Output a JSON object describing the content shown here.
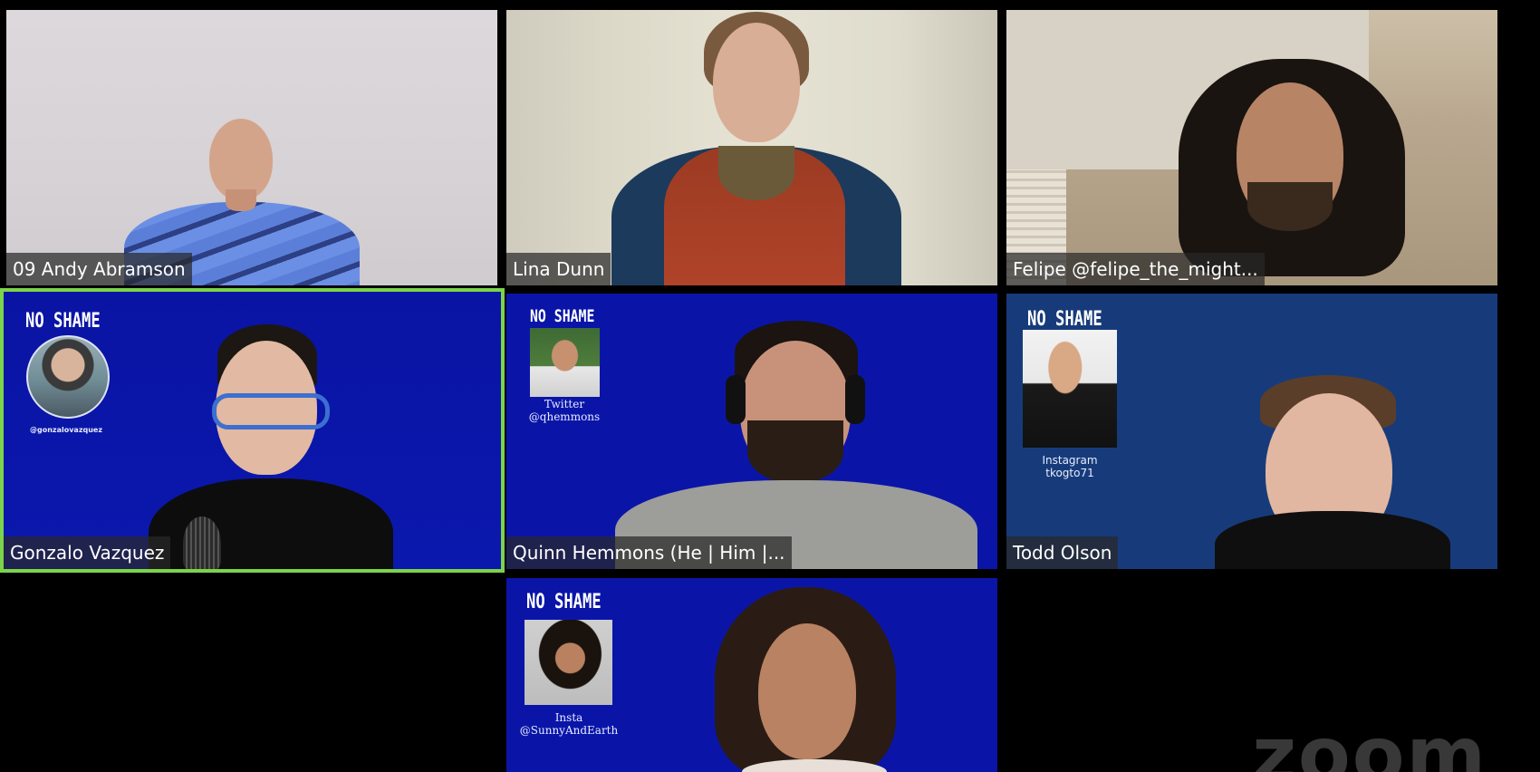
{
  "meeting": {
    "participants": [
      {
        "name": "09 Andy Abramson"
      },
      {
        "name": "Lina Dunn"
      },
      {
        "name": "Felipe @felipe_the_might..."
      },
      {
        "name": "Gonzalo Vazquez",
        "active_speaker": true,
        "background": {
          "title": "NO SHAME",
          "handle": "@gonzalovazquez"
        }
      },
      {
        "name": "Quinn Hemmons (He | Him |...",
        "background": {
          "title": "NO SHAME",
          "social_platform": "Twitter",
          "handle": "@qhemmons"
        }
      },
      {
        "name": "Todd Olson",
        "background": {
          "title": "NO SHAME",
          "social_platform": "Instagram",
          "handle": "tkogto71"
        }
      },
      {
        "background": {
          "title": "NO SHAME",
          "social_platform": "Insta",
          "handle": "@SunnyAndEarth"
        }
      }
    ],
    "watermark": "zoom"
  },
  "colors": {
    "active_speaker_border": "#7cd44a",
    "no_shame_blue": "#0b15a6",
    "todd_blue": "#173b7a"
  }
}
